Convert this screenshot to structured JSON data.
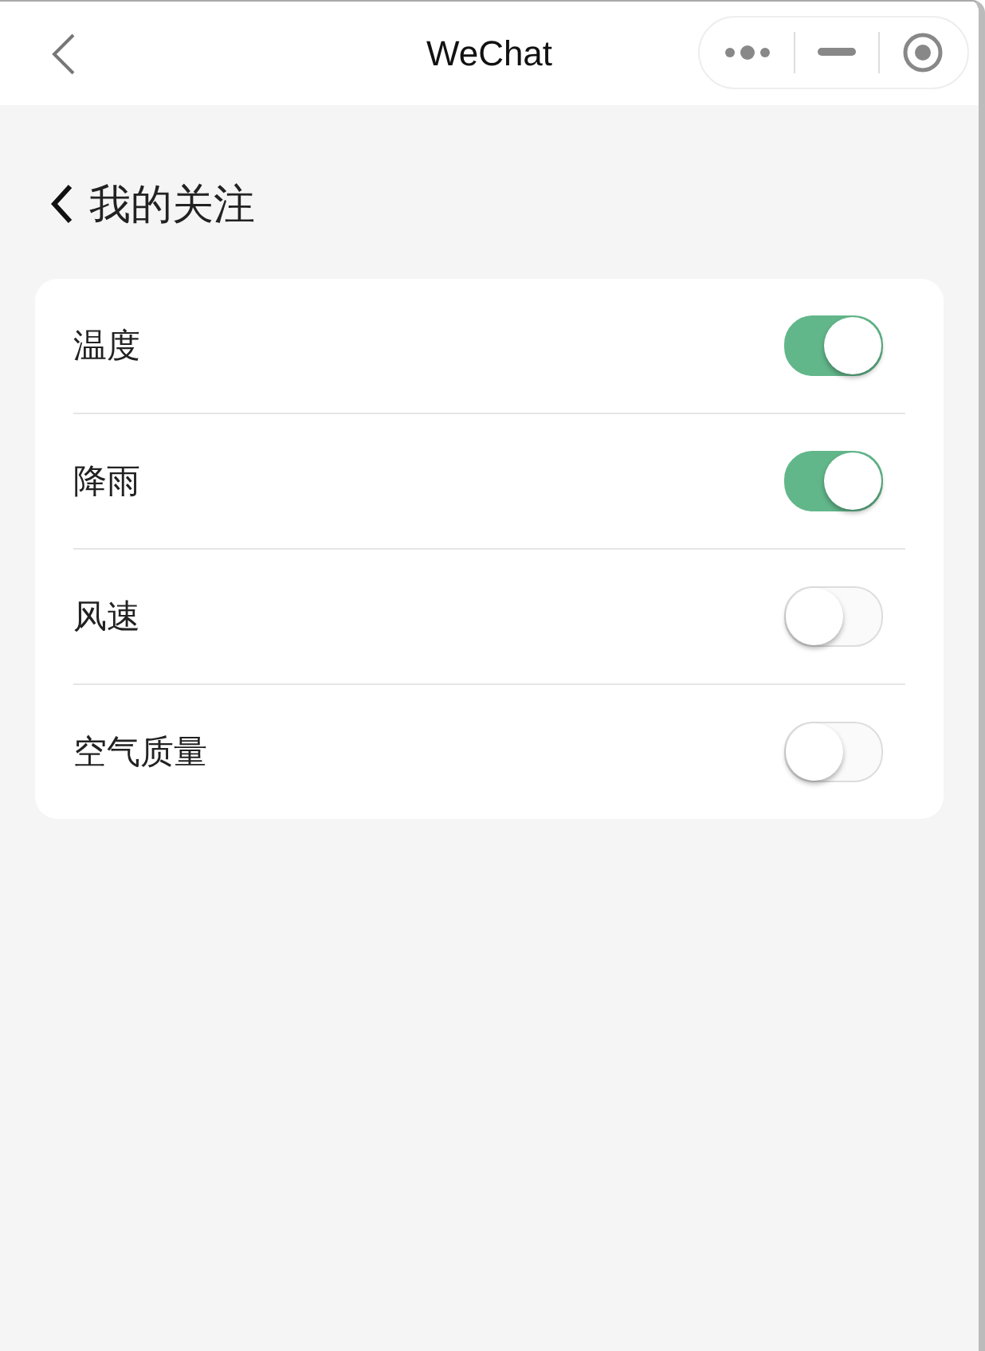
{
  "top_bar": {
    "title": "WeChat"
  },
  "page": {
    "title": "我的关注"
  },
  "settings": [
    {
      "label": "温度",
      "on": true
    },
    {
      "label": "降雨",
      "on": true
    },
    {
      "label": "风速",
      "on": false
    },
    {
      "label": "空气质量",
      "on": false
    }
  ]
}
